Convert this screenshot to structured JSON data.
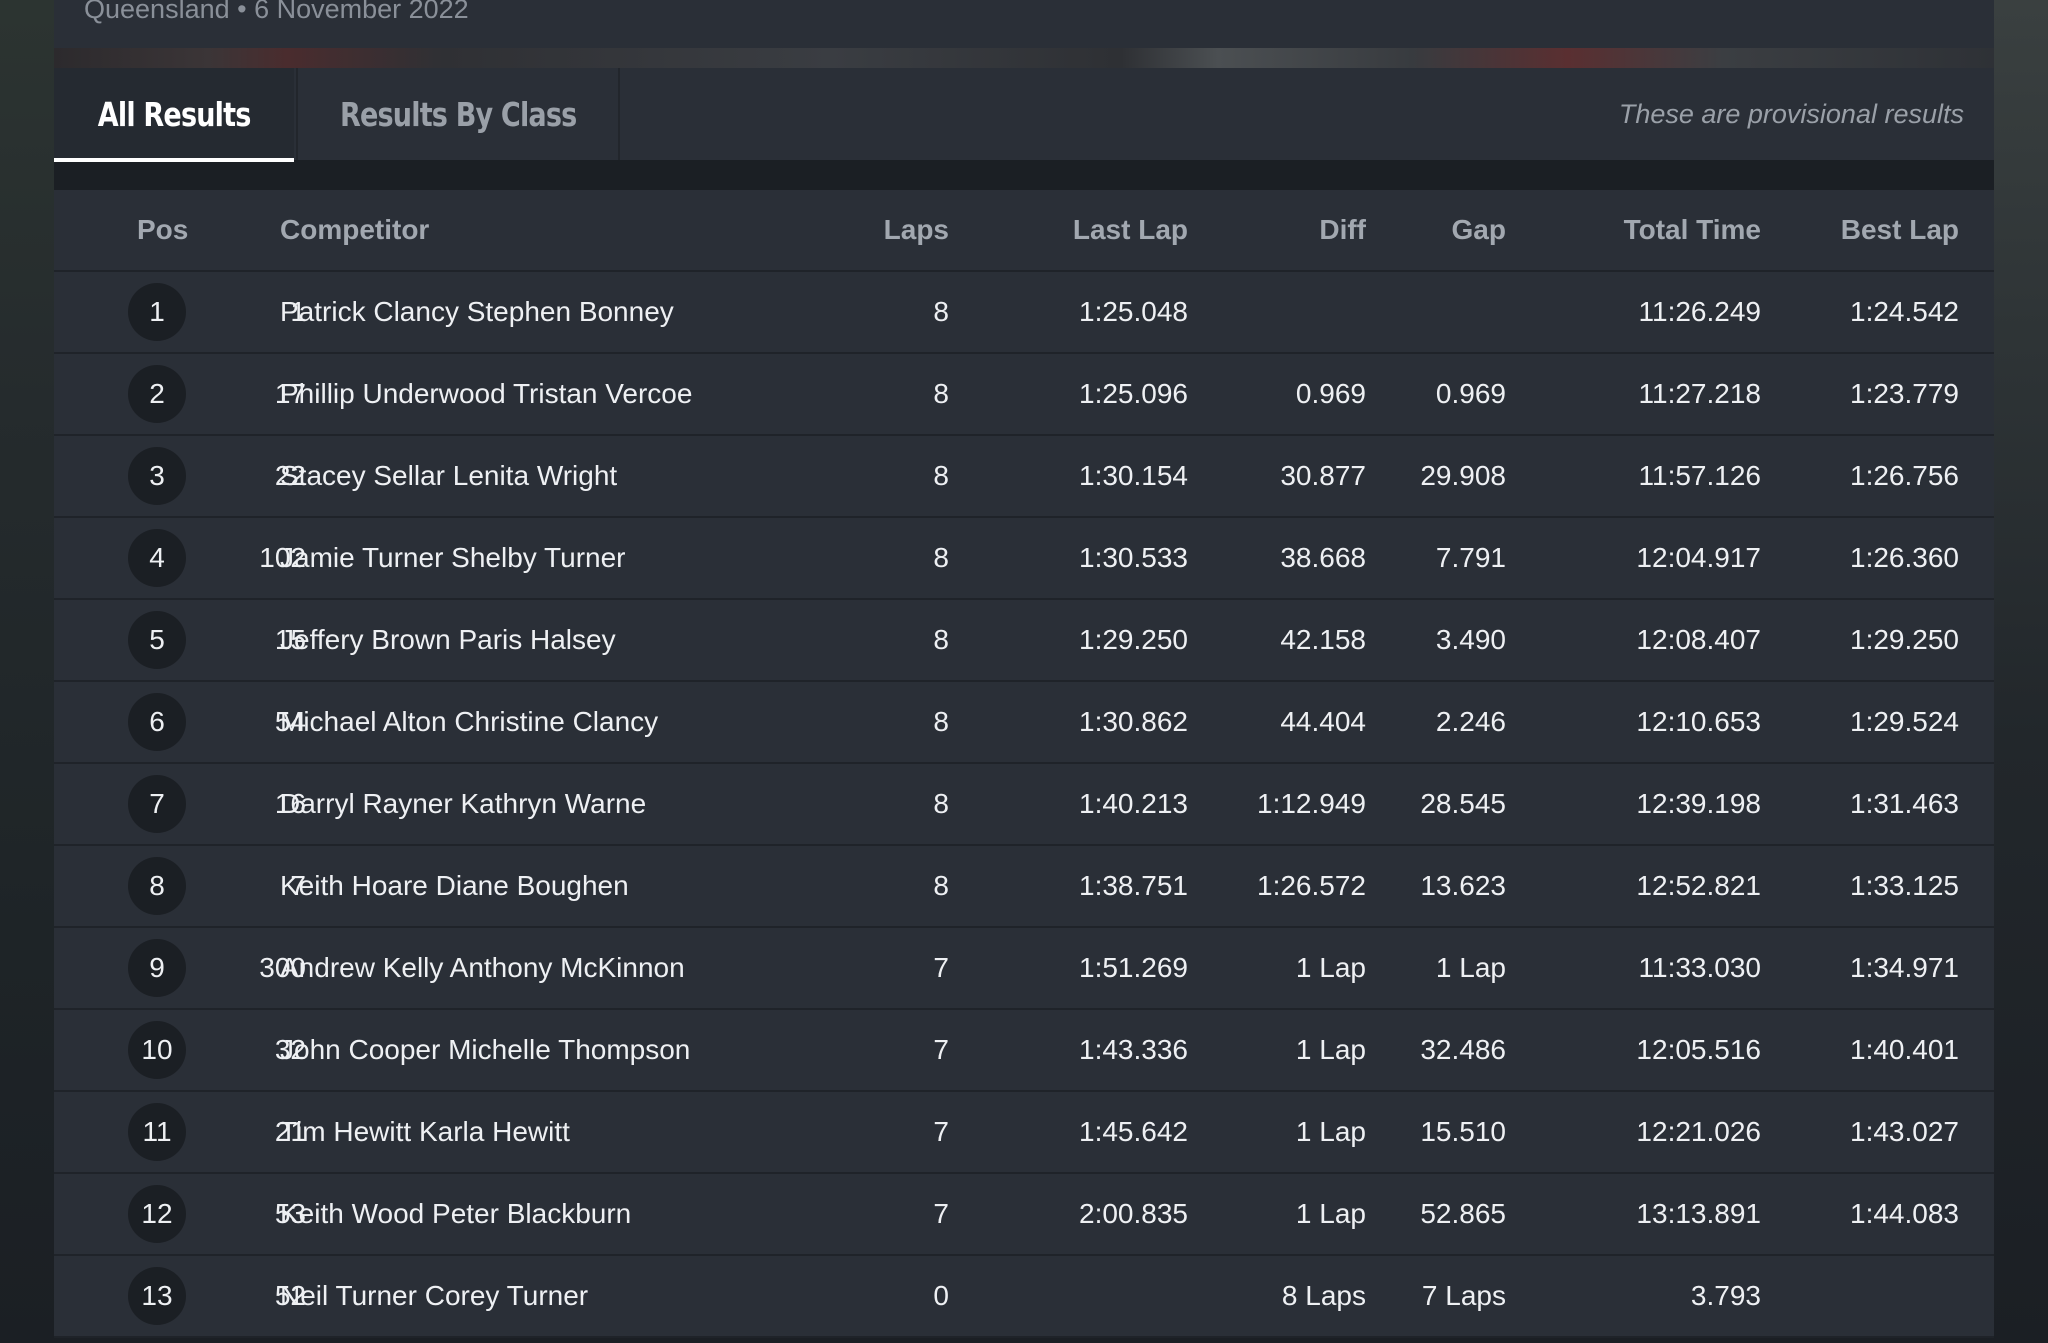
{
  "header": {
    "subtitle": "Queensland • 6 November 2022"
  },
  "tabs": {
    "all_results": "All Results",
    "by_class": "Results By Class",
    "provisional_note": "These are provisional results"
  },
  "table": {
    "columns": {
      "pos": "Pos",
      "competitor": "Competitor",
      "laps": "Laps",
      "last_lap": "Last Lap",
      "diff": "Diff",
      "gap": "Gap",
      "total_time": "Total Time",
      "best_lap": "Best Lap"
    },
    "rows": [
      {
        "pos": "1",
        "num": "1",
        "name": "Patrick Clancy Stephen Bonney",
        "laps": "8",
        "last": "1:25.048",
        "diff": "",
        "gap": "",
        "total": "11:26.249",
        "best": "1:24.542"
      },
      {
        "pos": "2",
        "num": "17",
        "name": "Phillip Underwood Tristan Vercoe",
        "laps": "8",
        "last": "1:25.096",
        "diff": "0.969",
        "gap": "0.969",
        "total": "11:27.218",
        "best": "1:23.779"
      },
      {
        "pos": "3",
        "num": "22",
        "name": "Stacey Sellar Lenita Wright",
        "laps": "8",
        "last": "1:30.154",
        "diff": "30.877",
        "gap": "29.908",
        "total": "11:57.126",
        "best": "1:26.756"
      },
      {
        "pos": "4",
        "num": "102",
        "name": "Jamie Turner Shelby Turner",
        "laps": "8",
        "last": "1:30.533",
        "diff": "38.668",
        "gap": "7.791",
        "total": "12:04.917",
        "best": "1:26.360"
      },
      {
        "pos": "5",
        "num": "15",
        "name": "Jeffery Brown Paris Halsey",
        "laps": "8",
        "last": "1:29.250",
        "diff": "42.158",
        "gap": "3.490",
        "total": "12:08.407",
        "best": "1:29.250"
      },
      {
        "pos": "6",
        "num": "54",
        "name": "Michael Alton Christine Clancy",
        "laps": "8",
        "last": "1:30.862",
        "diff": "44.404",
        "gap": "2.246",
        "total": "12:10.653",
        "best": "1:29.524"
      },
      {
        "pos": "7",
        "num": "16",
        "name": "Darryl Rayner Kathryn Warne",
        "laps": "8",
        "last": "1:40.213",
        "diff": "1:12.949",
        "gap": "28.545",
        "total": "12:39.198",
        "best": "1:31.463"
      },
      {
        "pos": "8",
        "num": "7",
        "name": "Keith Hoare Diane Boughen",
        "laps": "8",
        "last": "1:38.751",
        "diff": "1:26.572",
        "gap": "13.623",
        "total": "12:52.821",
        "best": "1:33.125"
      },
      {
        "pos": "9",
        "num": "300",
        "name": "Andrew Kelly Anthony McKinnon",
        "laps": "7",
        "last": "1:51.269",
        "diff": "1 Lap",
        "gap": "1 Lap",
        "total": "11:33.030",
        "best": "1:34.971"
      },
      {
        "pos": "10",
        "num": "32",
        "name": "John Cooper Michelle Thompson",
        "laps": "7",
        "last": "1:43.336",
        "diff": "1 Lap",
        "gap": "32.486",
        "total": "12:05.516",
        "best": "1:40.401"
      },
      {
        "pos": "11",
        "num": "21",
        "name": "Tim Hewitt Karla Hewitt",
        "laps": "7",
        "last": "1:45.642",
        "diff": "1 Lap",
        "gap": "15.510",
        "total": "12:21.026",
        "best": "1:43.027"
      },
      {
        "pos": "12",
        "num": "53",
        "name": "Keith Wood Peter Blackburn",
        "laps": "7",
        "last": "2:00.835",
        "diff": "1 Lap",
        "gap": "52.865",
        "total": "13:13.891",
        "best": "1:44.083"
      },
      {
        "pos": "13",
        "num": "52",
        "name": "Neil Turner Corey Turner",
        "laps": "0",
        "last": "",
        "diff": "8 Laps",
        "gap": "7 Laps",
        "total": "3.793",
        "best": ""
      }
    ]
  }
}
